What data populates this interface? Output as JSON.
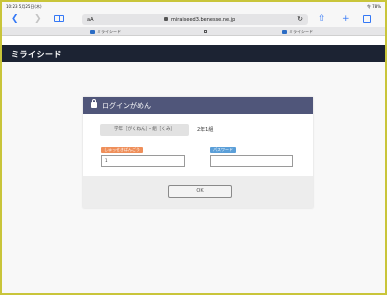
{
  "statusbar": {
    "time": "10:23  5月25日(木)",
    "battery": "令 78%"
  },
  "toolbar": {
    "aa_label": "aA",
    "url": "miraiseed3.benesse.ne.jp"
  },
  "tabs": [
    {
      "label": "ミライシード"
    },
    {
      "label": ""
    },
    {
      "label": "ミライシード"
    }
  ],
  "app": {
    "logo": "ミライシード"
  },
  "login": {
    "title": "ログインがめん",
    "school": "学年［がくねん］・組［くみ］",
    "grade": "2年1組",
    "user_label": "しゅっせきばんごう",
    "password_label": "パスワード",
    "user_value": "1",
    "password_value": "",
    "ok_label": "OK"
  },
  "colors": {
    "page_frame": "#c9c53a",
    "app_header": "#1c2333",
    "panel_header": "#50567a",
    "user_label_bg": "#ef8f5a",
    "password_label_bg": "#5b9fd8"
  }
}
